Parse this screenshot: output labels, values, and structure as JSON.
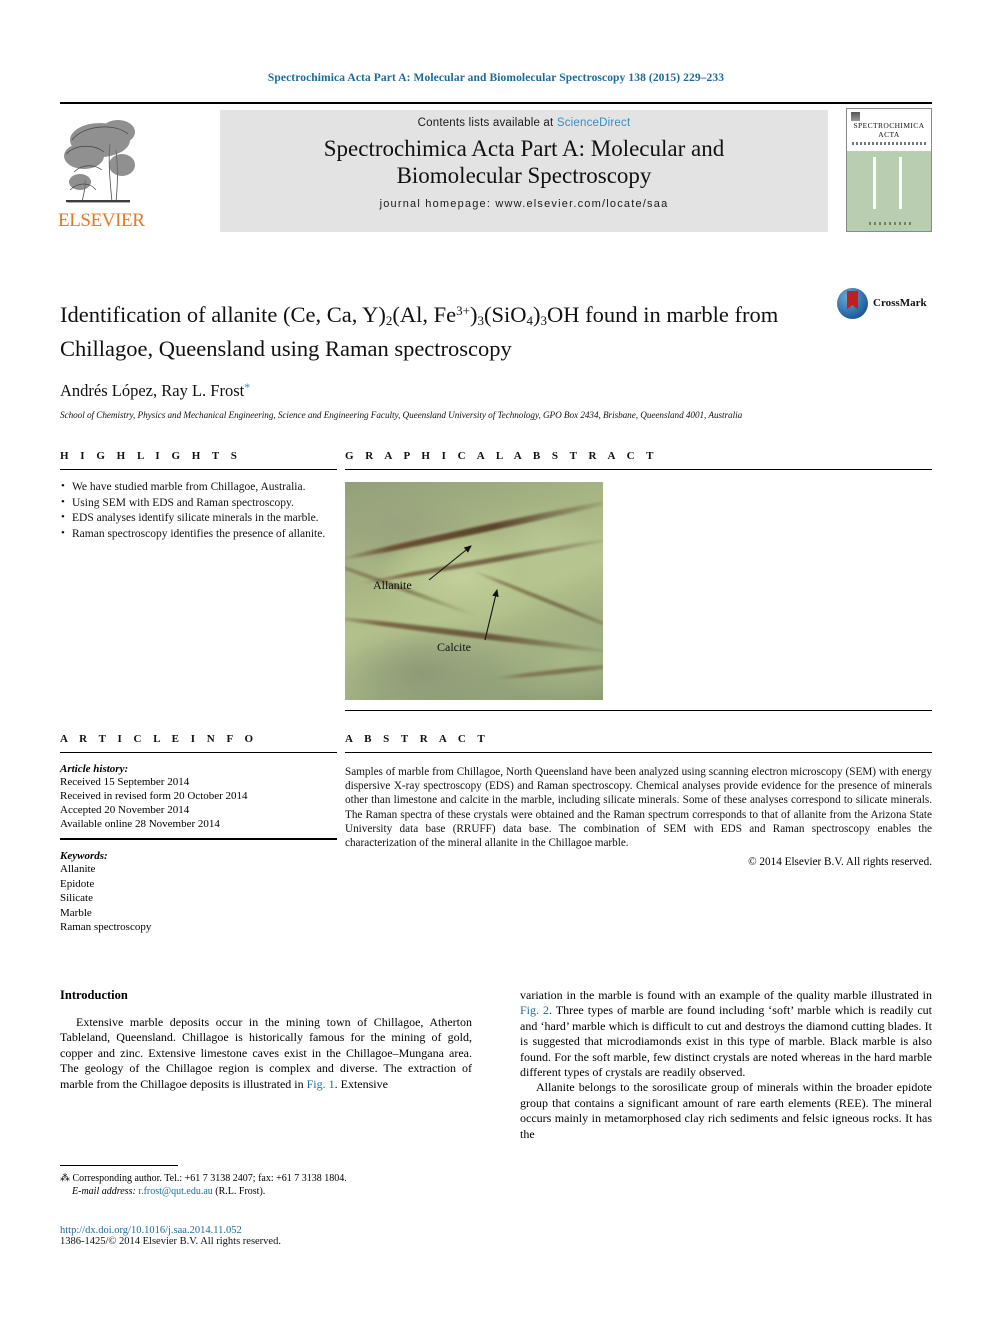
{
  "running_head": "Spectrochimica Acta Part A: Molecular and Biomolecular Spectroscopy 138 (2015) 229–233",
  "masthead": {
    "publisher_name": "ELSEVIER",
    "contents_prefix": "Contents lists available at ",
    "sciencedirect": "ScienceDirect",
    "journal_title_line1": "Spectrochimica Acta Part A: Molecular and",
    "journal_title_line2": "Biomolecular Spectroscopy",
    "homepage": "journal homepage: www.elsevier.com/locate/saa",
    "cover_title_line1": "SPECTROCHIMICA",
    "cover_title_line2": "ACTA",
    "sciencedirect_color": "#3a8cbf",
    "banner_bg": "#e3e3e3"
  },
  "article": {
    "title_part1": "Identification of allanite (Ce, Ca, Y)",
    "title_sub1": "2",
    "title_part2": "(Al, Fe",
    "title_sup1": "3+",
    "title_part3": ")",
    "title_sub2": "3",
    "title_part4": "(SiO",
    "title_sub3": "4",
    "title_part5": ")",
    "title_sub4": "3",
    "title_part6": "OH found in marble from Chillagoe, Queensland using Raman spectroscopy",
    "authors": "Andrés López, Ray L. Frost",
    "corresponding_marker": "*",
    "affiliation": "School of Chemistry, Physics and Mechanical Engineering, Science and Engineering Faculty, Queensland University of Technology, GPO Box 2434, Brisbane, Queensland 4001, Australia",
    "crossmark_label": "CrossMark"
  },
  "highlights": {
    "heading": "H I G H L I G H T S",
    "items": [
      "We have studied marble from Chillagoe, Australia.",
      "Using SEM with EDS and Raman spectroscopy.",
      "EDS analyses identify silicate minerals in the marble.",
      "Raman spectroscopy identifies the presence of allanite."
    ]
  },
  "graphical_abstract": {
    "heading": "G R A P H I C A L   A B S T R A C T",
    "label_allanite": "Allanite",
    "label_calcite": "Calcite"
  },
  "article_info": {
    "heading": "A R T I C L E   I N F O",
    "history_label": "Article history:",
    "history": [
      "Received 15 September 2014",
      "Received in revised form 20 October 2014",
      "Accepted 20 November 2014",
      "Available online 28 November 2014"
    ],
    "keywords_label": "Keywords:",
    "keywords": [
      "Allanite",
      "Epidote",
      "Silicate",
      "Marble",
      "Raman spectroscopy"
    ]
  },
  "abstract": {
    "heading": "A B S T R A C T",
    "body": "Samples of marble from Chillagoe, North Queensland have been analyzed using scanning electron microscopy (SEM) with energy dispersive X-ray spectroscopy (EDS) and Raman spectroscopy. Chemical analyses provide evidence for the presence of minerals other than limestone and calcite in the marble, including silicate minerals. Some of these analyses correspond to silicate minerals. The Raman spectra of these crystals were obtained and the Raman spectrum corresponds to that of allanite from the Arizona State University data base (RRUFF) data base. The combination of SEM with EDS and Raman spectroscopy enables the characterization of the mineral allanite in the Chillagoe marble.",
    "copyright": "© 2014 Elsevier B.V. All rights reserved."
  },
  "body": {
    "intro_heading": "Introduction",
    "left_para_a": "Extensive marble deposits occur in the mining town of Chillagoe, Atherton Tableland, Queensland. Chillagoe is historically famous for the mining of gold, copper and zinc. Extensive limestone caves exist in the Chillagoe–Mungana area. The geology of the Chillagoe region is complex and diverse. The extraction of marble from the Chillagoe deposits is illustrated in ",
    "left_link": "Fig. 1",
    "left_para_b": ". Extensive",
    "right_para_a": "variation in the marble is found with an example of the quality marble illustrated in ",
    "right_link": "Fig. 2",
    "right_para_b": ". Three types of marble are found including ‘soft’ marble which is readily cut and ‘hard’ marble which is difficult to cut and destroys the diamond cutting blades. It is suggested that microdiamonds exist in this type of marble. Black marble is also found. For the soft marble, few distinct crystals are noted whereas in the hard marble different types of crystals are readily observed.",
    "right_para_c": "Allanite belongs to the sorosilicate group of minerals within the broader epidote group that contains a significant amount of rare earth elements (REE). The mineral occurs mainly in metamorphosed clay rich sediments and felsic igneous rocks. It has the"
  },
  "footnotes": {
    "corresponding": "Corresponding author. Tel.: +61 7 3138 2407; fax: +61 7 3138 1804.",
    "email_label": "E-mail address:",
    "email": "r.frost@qut.edu.au",
    "email_owner": "(R.L. Frost).",
    "doi": "http://dx.doi.org/10.1016/j.saa.2014.11.052",
    "issn_line": "1386-1425/© 2014 Elsevier B.V. All rights reserved."
  }
}
